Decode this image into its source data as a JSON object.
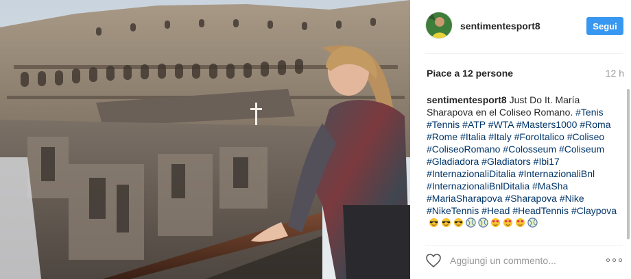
{
  "post": {
    "username": "sentimentesport8",
    "follow_label": "Segui",
    "likes": "Piace a 12 persone",
    "time": "12 h",
    "caption_user": "sentimentesport8",
    "caption_text": "Just Do It. María Sharapova en el Coliseo Romano.",
    "hashtags": [
      "#Tenis",
      "#Tennis",
      "#ATP",
      "#WTA",
      "#Masters1000",
      "#Roma",
      "#Rome",
      "#Italia",
      "#Italy",
      "#ForoItalico",
      "#Coliseo",
      "#ColiseoRomano",
      "#Colosseum",
      "#Coliseum",
      "#Gladiadora",
      "#Gladiators",
      "#Ibi17",
      "#InternazionaliDitalia",
      "#InternazionaliBnl",
      "#InternazionaliBnlDitalia",
      "#MaSha",
      "#MariaSharapova",
      "#Sharapova",
      "#Nike",
      "#NikeTennis",
      "#Head",
      "#HeadTennis",
      "#Claypova"
    ],
    "emojis": [
      "sunglasses",
      "sunglasses",
      "sunglasses",
      "tennis-ball",
      "tennis-ball",
      "heart-eyes",
      "heart-eyes",
      "heart-eyes",
      "tennis-ball"
    ],
    "comment_placeholder": "Aggiungi un commento...",
    "icons": {
      "like": "heart-outline-icon",
      "more": "more-options-icon"
    },
    "colors": {
      "accent": "#3897f0",
      "hashtag": "#003569",
      "text": "#262626",
      "muted": "#999999"
    }
  }
}
